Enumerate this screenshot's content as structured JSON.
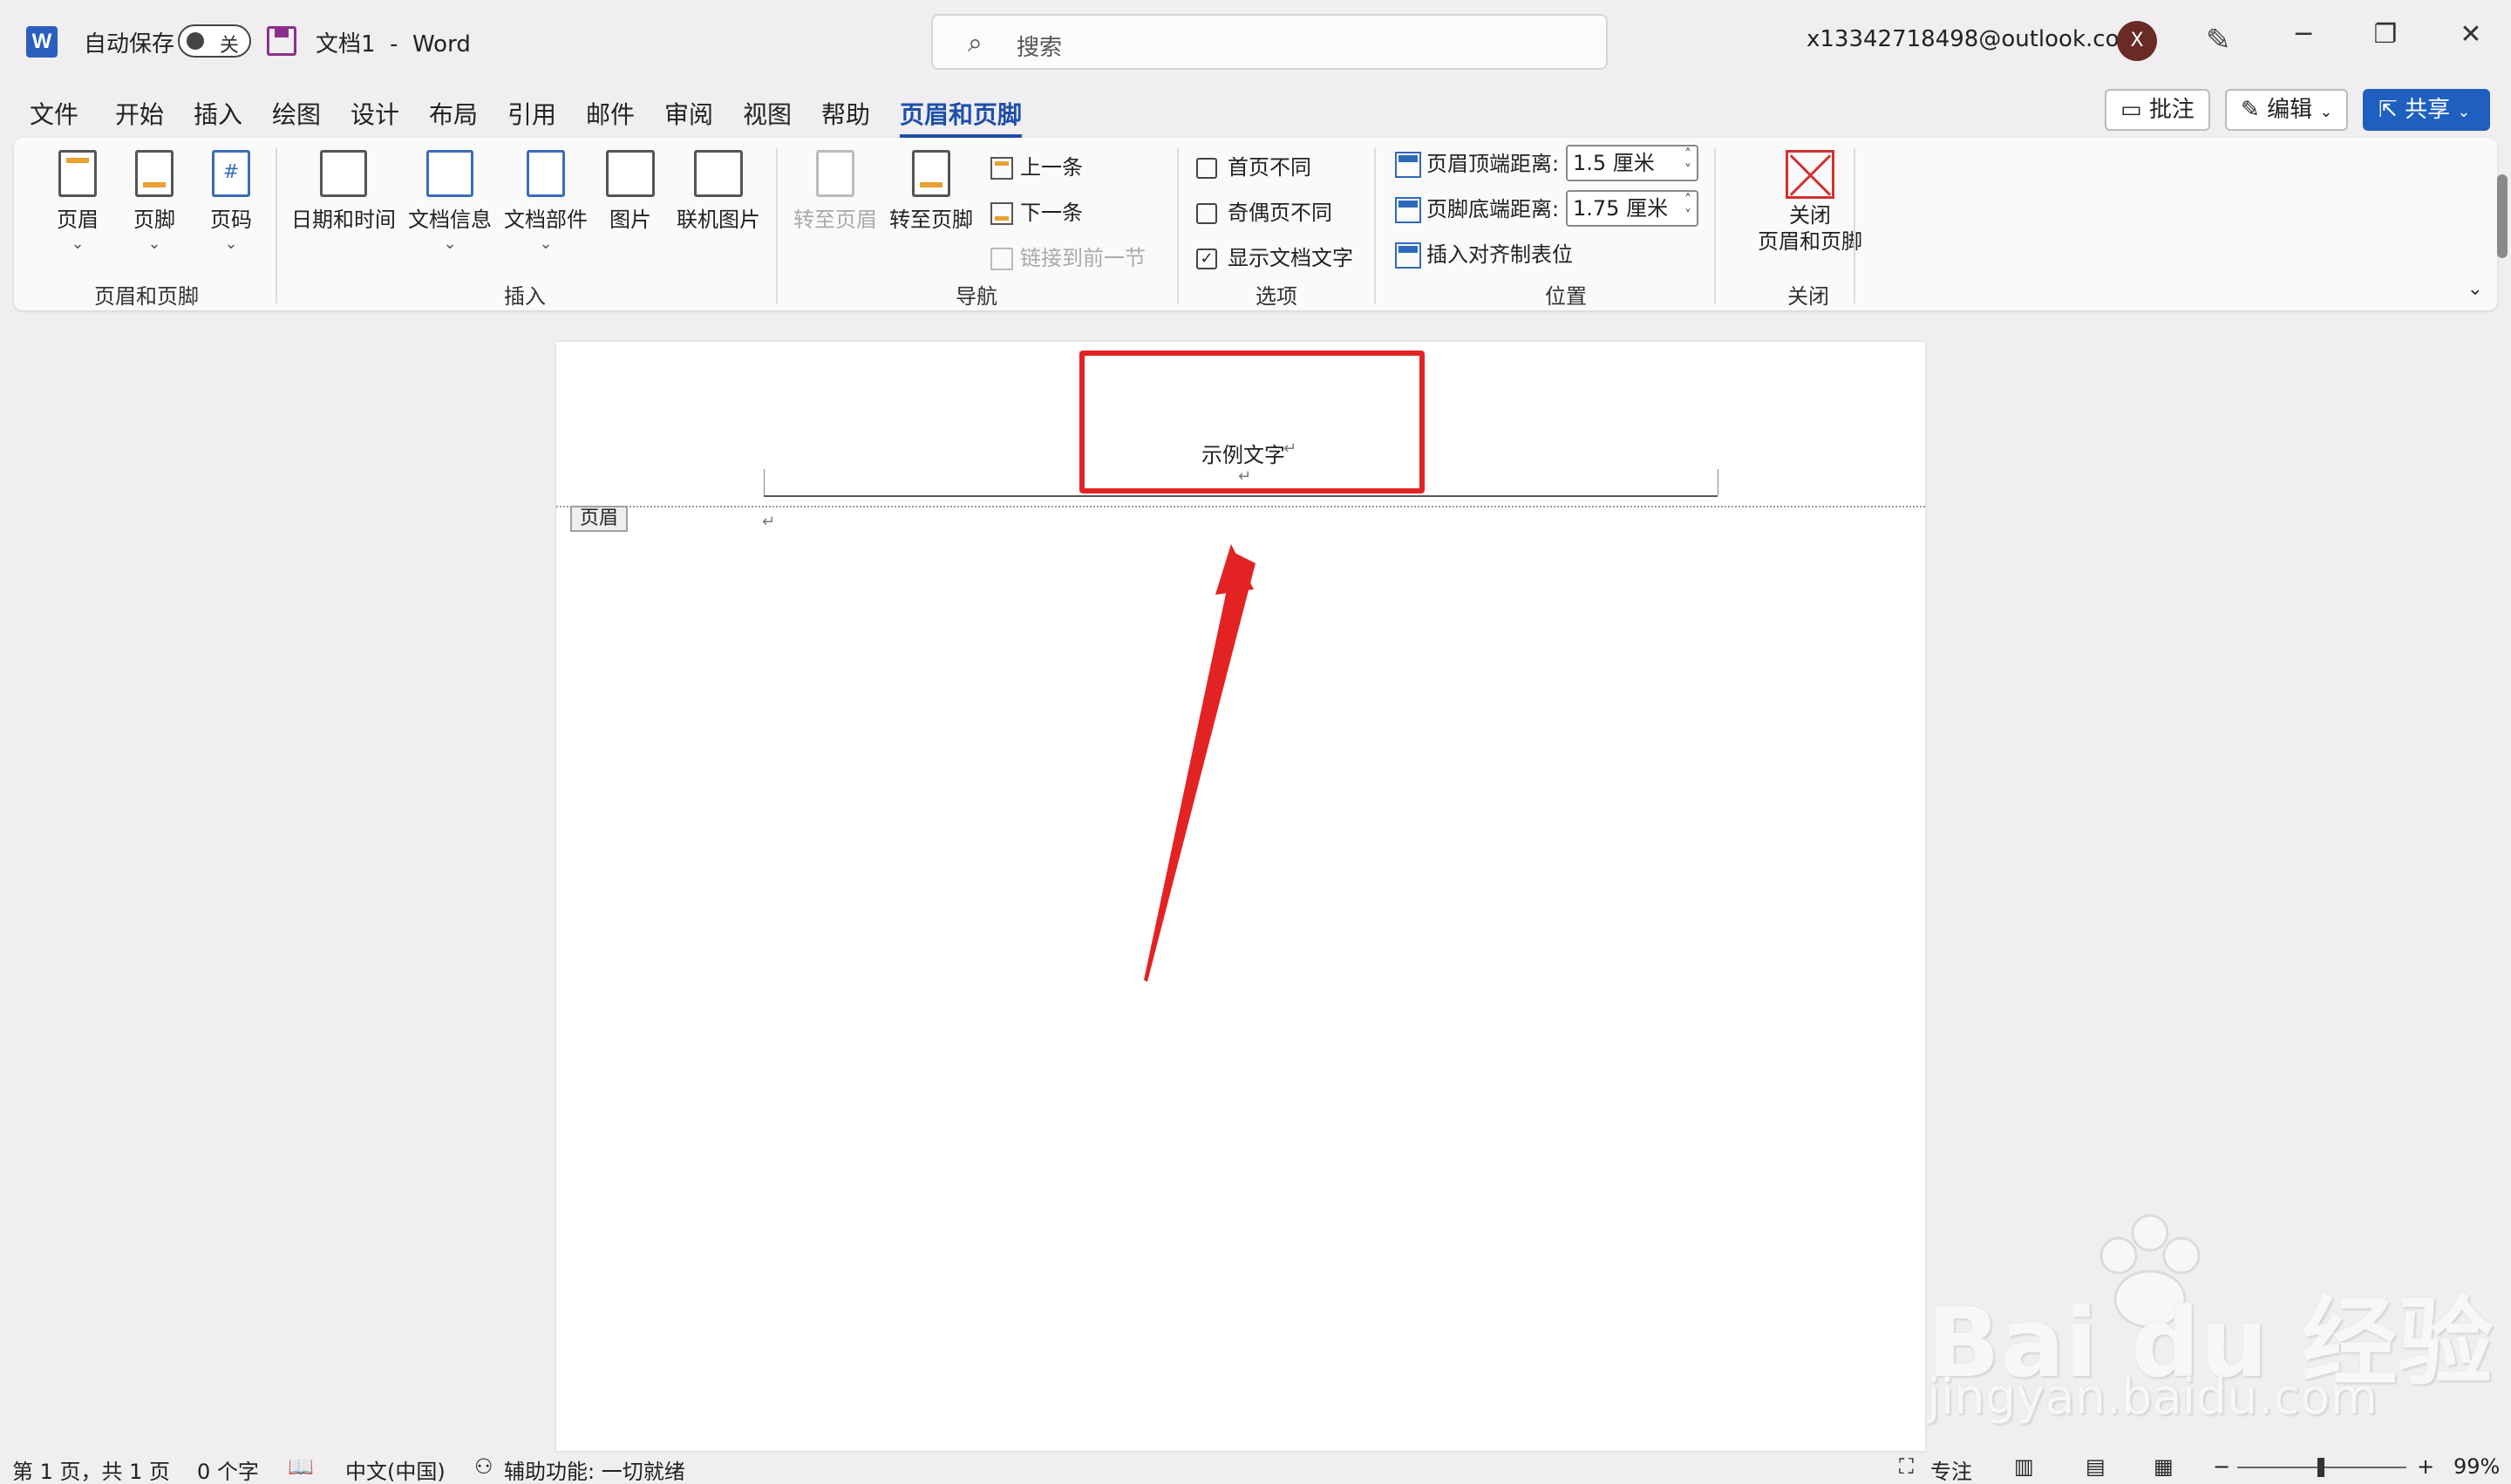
{
  "titlebar": {
    "app_icon": "W",
    "autosave_label": "自动保存",
    "autosave_state": "关",
    "doc_name": "文档1",
    "separator": "-",
    "app_name": "Word",
    "search_placeholder": "搜索",
    "account": "x13342718498@outlook.com",
    "avatar_initial": "X"
  },
  "menu": {
    "tabs": [
      "文件",
      "开始",
      "插入",
      "绘图",
      "设计",
      "布局",
      "引用",
      "邮件",
      "审阅",
      "视图",
      "帮助",
      "页眉和页脚"
    ],
    "active_tab": "页眉和页脚",
    "comment_btn": "批注",
    "edit_btn": "编辑",
    "share_btn": "共享"
  },
  "ribbon": {
    "group1": {
      "label": "页眉和页脚",
      "buttons": [
        "页眉",
        "页脚",
        "页码"
      ]
    },
    "group2": {
      "label": "插入",
      "buttons": [
        "日期和时间",
        "文档信息",
        "文档部件",
        "图片",
        "联机图片"
      ]
    },
    "group3": {
      "label": "导航",
      "goto_header": "转至页眉",
      "goto_footer": "转至页脚",
      "prev": "上一条",
      "next": "下一条",
      "link_prev": "链接到前一节"
    },
    "group4": {
      "label": "选项",
      "first_page": "首页不同",
      "odd_even": "奇偶页不同",
      "show_doc_text": "显示文档文字",
      "show_doc_text_checked": true
    },
    "group5": {
      "label": "位置",
      "header_top": "页眉顶端距离:",
      "header_top_value": "1.5 厘米",
      "footer_bottom": "页脚底端距离:",
      "footer_bottom_value": "1.75 厘米",
      "insert_tab": "插入对齐制表位"
    },
    "group6": {
      "label": "关闭",
      "close_line1": "关闭",
      "close_line2": "页眉和页脚"
    }
  },
  "document": {
    "header_text": "示例文字",
    "header_tag": "页眉",
    "paragraph_mark": "↵"
  },
  "status": {
    "page": "第 1 页，共 1 页",
    "words": "0 个字",
    "language": "中文(中国)",
    "accessibility": "辅助功能: 一切就绪",
    "focus": "专注",
    "zoom": "99%"
  },
  "watermark": {
    "brand": "Bai du 经验",
    "url": "jingyan.baidu.com"
  },
  "colors": {
    "accent": "#1d4fa8",
    "share_bg": "#1e5fbf",
    "highlight_red": "#e32323"
  }
}
